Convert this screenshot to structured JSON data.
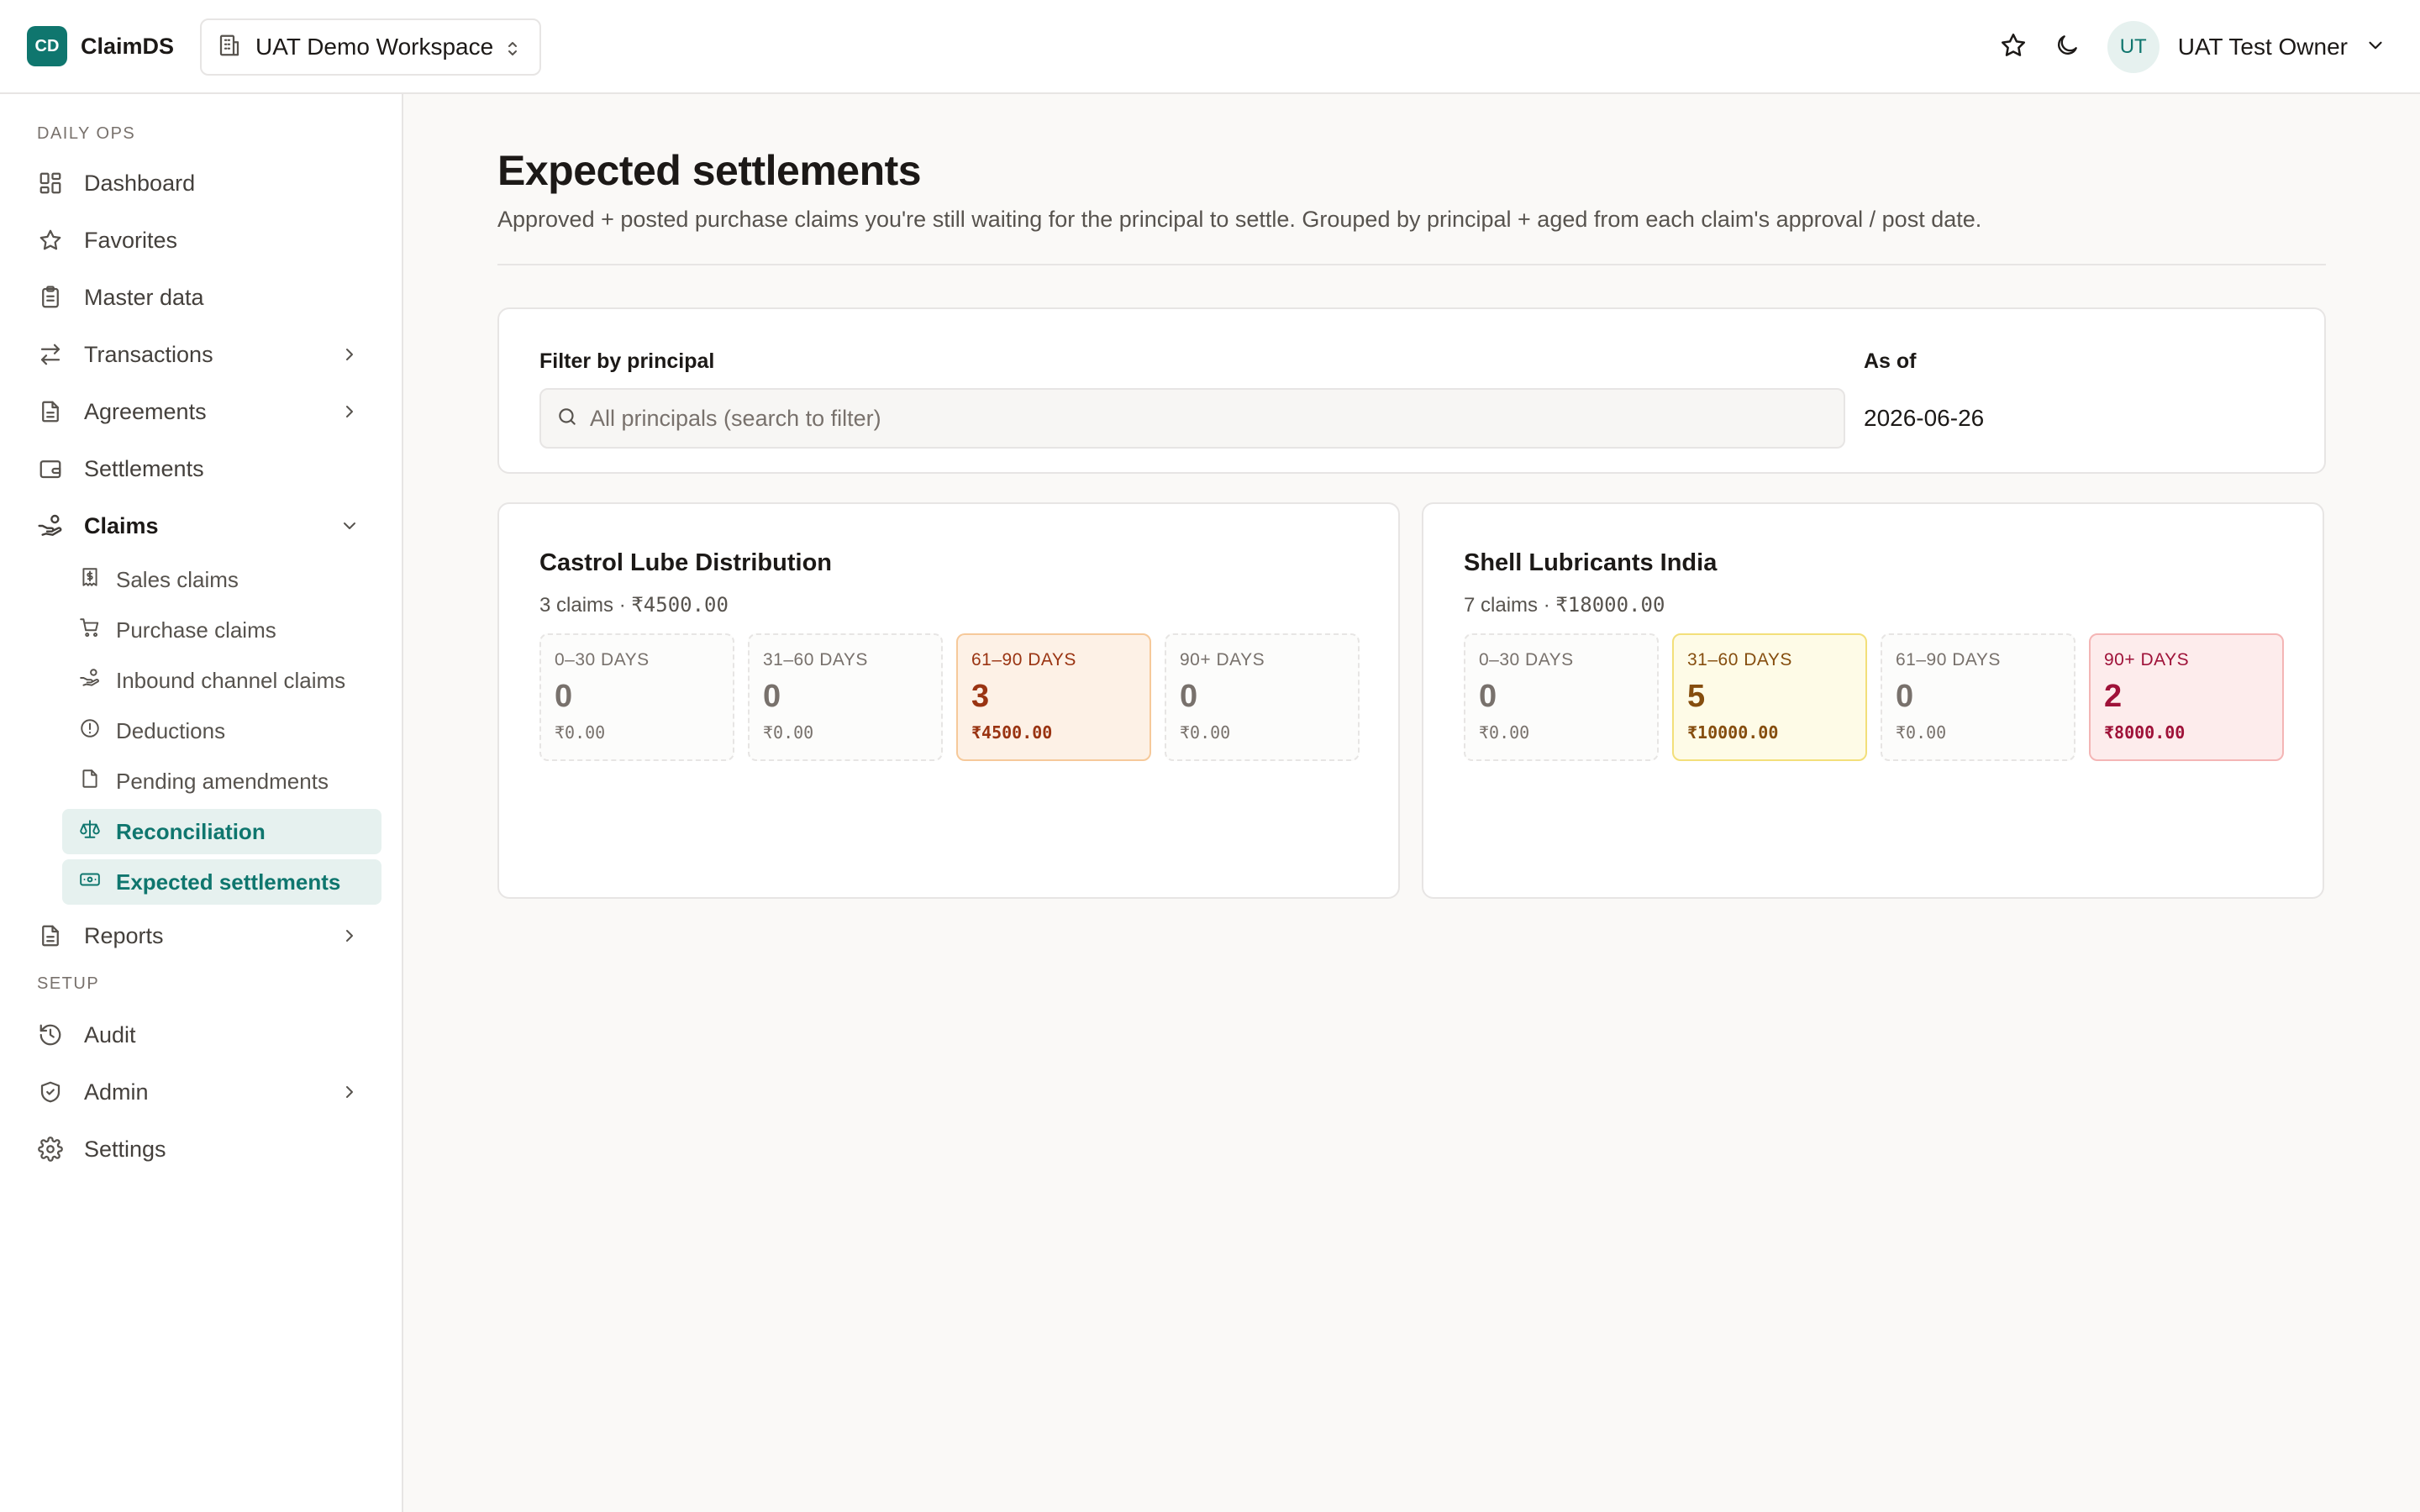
{
  "app": {
    "logo_text": "CD",
    "name": "ClaimDS"
  },
  "workspace": {
    "label": "UAT Demo Workspace"
  },
  "user": {
    "initials": "UT",
    "name": "UAT Test Owner"
  },
  "sidebar": {
    "sections": {
      "daily_ops": "DAILY OPS",
      "setup": "SETUP"
    },
    "items": {
      "dashboard": "Dashboard",
      "favorites": "Favorites",
      "master_data": "Master data",
      "transactions": "Transactions",
      "agreements": "Agreements",
      "settlements": "Settlements",
      "claims": "Claims",
      "reports": "Reports",
      "audit": "Audit",
      "admin": "Admin",
      "settings": "Settings"
    },
    "claims_sub": {
      "sales": "Sales claims",
      "purchase": "Purchase claims",
      "inbound": "Inbound channel claims",
      "deductions": "Deductions",
      "pending": "Pending amendments",
      "reconciliation": "Reconciliation",
      "expected": "Expected settlements"
    }
  },
  "page": {
    "title": "Expected settlements",
    "description": "Approved + posted purchase claims you're still waiting for the principal to settle. Grouped by principal + aged from each claim's approval / post date."
  },
  "filter": {
    "label": "Filter by principal",
    "placeholder": "All principals (search to filter)",
    "as_of_label": "As of",
    "as_of_value": "2026-06-26"
  },
  "principals": [
    {
      "name": "Castrol Lube Distribution",
      "claims": "3 claims · ",
      "total": "₹4500.00",
      "buckets": [
        {
          "label": "0–30 DAYS",
          "count": "0",
          "amount": "₹0.00"
        },
        {
          "label": "31–60 DAYS",
          "count": "0",
          "amount": "₹0.00"
        },
        {
          "label": "61–90 DAYS",
          "count": "3",
          "amount": "₹4500.00"
        },
        {
          "label": "90+ DAYS",
          "count": "0",
          "amount": "₹0.00"
        }
      ]
    },
    {
      "name": "Shell Lubricants India",
      "claims": "7 claims · ",
      "total": "₹18000.00",
      "buckets": [
        {
          "label": "0–30 DAYS",
          "count": "0",
          "amount": "₹0.00"
        },
        {
          "label": "31–60 DAYS",
          "count": "5",
          "amount": "₹10000.00"
        },
        {
          "label": "61–90 DAYS",
          "count": "0",
          "amount": "₹0.00"
        },
        {
          "label": "90+ DAYS",
          "count": "2",
          "amount": "₹8000.00"
        }
      ]
    }
  ],
  "colors": {
    "brand": "#0f766e",
    "active_bg": "#e6f1ef",
    "bucket_orange": "#fdf1e6",
    "bucket_yellow": "#fefbe7",
    "bucket_red": "#fdecec"
  }
}
